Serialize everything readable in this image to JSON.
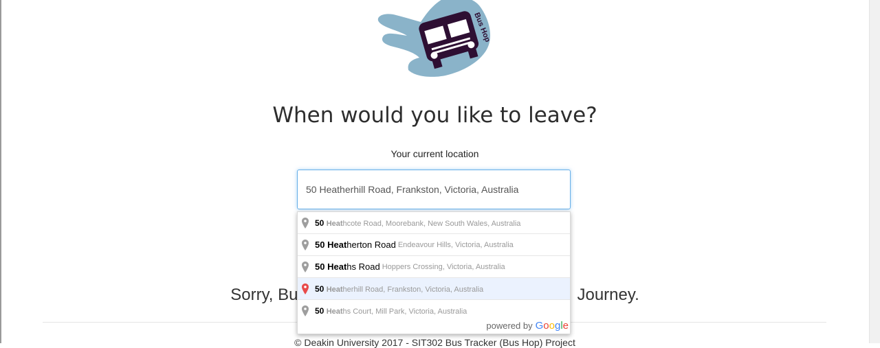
{
  "logo": {
    "text": "Bus Hop",
    "hand_color": "#8ab3c9",
    "bus_color": "#2e0f33"
  },
  "heading": "When would you like to leave?",
  "location_label": "Your current location",
  "location_input": {
    "value": "50 Heatherhill Road, Frankston, Victoria, Australia"
  },
  "autocomplete": {
    "items": [
      {
        "num": "50",
        "bold": "Heat",
        "rest": "hcote Road, Moorebank, New South Wales, Australia",
        "secondary": "",
        "selected": false
      },
      {
        "num": "50",
        "bold": "Heat",
        "rest": "herton Road",
        "secondary": "Endeavour Hills, Victoria, Australia",
        "selected": false
      },
      {
        "num": "50",
        "bold": "Heat",
        "rest": "hs Road",
        "secondary": "Hoppers Crossing, Victoria, Australia",
        "selected": false
      },
      {
        "num": "50",
        "bold": "Heat",
        "rest": "herhill Road, Frankston, Victoria, Australia",
        "secondary": "",
        "selected": true
      },
      {
        "num": "50",
        "bold": "Heat",
        "rest": "hs Court, Mill Park, Victoria, Australia",
        "secondary": "",
        "selected": false
      }
    ],
    "powered_by": "powered by",
    "google": "Google"
  },
  "message": {
    "left": "Sorry, Bu",
    "right": "Journey."
  },
  "footer": "© Deakin University 2017 - SIT302 Bus Tracker (Bus Hop) Project",
  "colors": {
    "pin_default": "#9e9e9e",
    "pin_selected": "#e84a4a",
    "focus": "#66afe9"
  }
}
